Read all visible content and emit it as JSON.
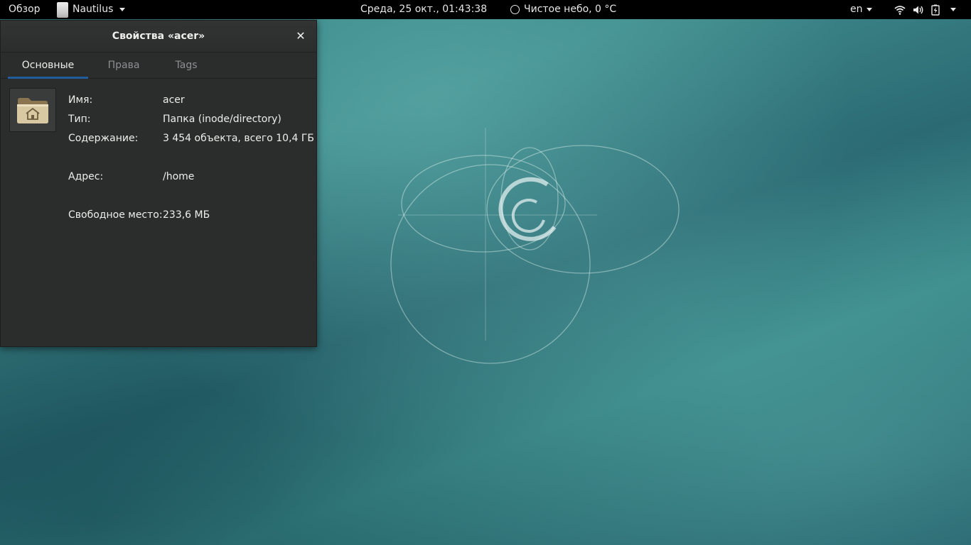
{
  "topbar": {
    "activities": "Обзор",
    "app_name": "Nautilus",
    "clock": "Среда, 25 окт., 01:43:38",
    "weather": "Чистое небо, 0 °C",
    "language": "en"
  },
  "dialog": {
    "title": "Свойства «acer»",
    "close_icon": "close-icon",
    "tabs": [
      {
        "label": "Основные",
        "active": true
      },
      {
        "label": "Права",
        "active": false
      },
      {
        "label": "Tags",
        "active": false
      }
    ],
    "icon": "home-folder-icon",
    "properties": {
      "name": {
        "label": "Имя:",
        "value": "acer"
      },
      "type": {
        "label": "Тип:",
        "value": "Папка (inode/directory)"
      },
      "contents": {
        "label": "Содержание:",
        "value": "3 454 объекта, всего 10,4 ГБ"
      },
      "location": {
        "label": "Адрес:",
        "value": "/home"
      },
      "free_space": {
        "label": "Свободное место:",
        "value": "233,6 МБ"
      }
    }
  },
  "colors": {
    "topbar_bg": "#000000",
    "dialog_bg": "#2b2c2c",
    "active_tab_underline": "#215d9c",
    "wallpaper": "#2f7d80"
  }
}
